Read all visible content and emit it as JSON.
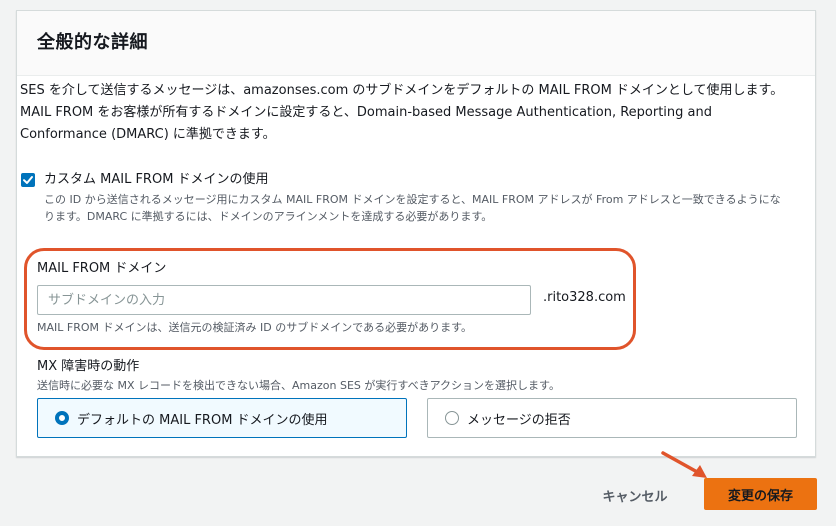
{
  "panel": {
    "title": "全般的な詳細",
    "description": "SES を介して送信するメッセージは、amazonses.com のサブドメインをデフォルトの MAIL FROM ドメインとして使用します。MAIL FROM をお客様が所有するドメインに設定すると、Domain-based Message Authentication, Reporting and Conformance (DMARC) に準拠できます。"
  },
  "custom_mail_from": {
    "checked": true,
    "label": "カスタム MAIL FROM ドメインの使用",
    "description": "この ID から送信されるメッセージ用にカスタム MAIL FROM ドメインを設定すると、MAIL FROM アドレスが From アドレスと一致できるようになります。DMARC に準拠するには、ドメインのアラインメントを達成する必要があります。"
  },
  "mail_from_domain": {
    "label": "MAIL FROM ドメイン",
    "value": "",
    "placeholder": "サブドメインの入力",
    "suffix": ".rito328.com",
    "help": "MAIL FROM ドメインは、送信元の検証済み ID のサブドメインである必要があります。"
  },
  "mx_failure": {
    "label": "MX 障害時の動作",
    "description": "送信時に必要な MX レコードを検出できない場合、Amazon SES が実行すべきアクションを選択します。",
    "options": [
      {
        "label": "デフォルトの MAIL FROM ドメインの使用",
        "selected": true
      },
      {
        "label": "メッセージの拒否",
        "selected": false
      }
    ]
  },
  "footer": {
    "cancel_label": "キャンセル",
    "save_label": "変更の保存"
  },
  "colors": {
    "accent": "#0073bb",
    "primary_button": "#ec7211",
    "annotation": "#e0542b"
  },
  "icons": {
    "checkbox": "checkmark-icon",
    "annotation_arrow": "arrow-icon"
  }
}
